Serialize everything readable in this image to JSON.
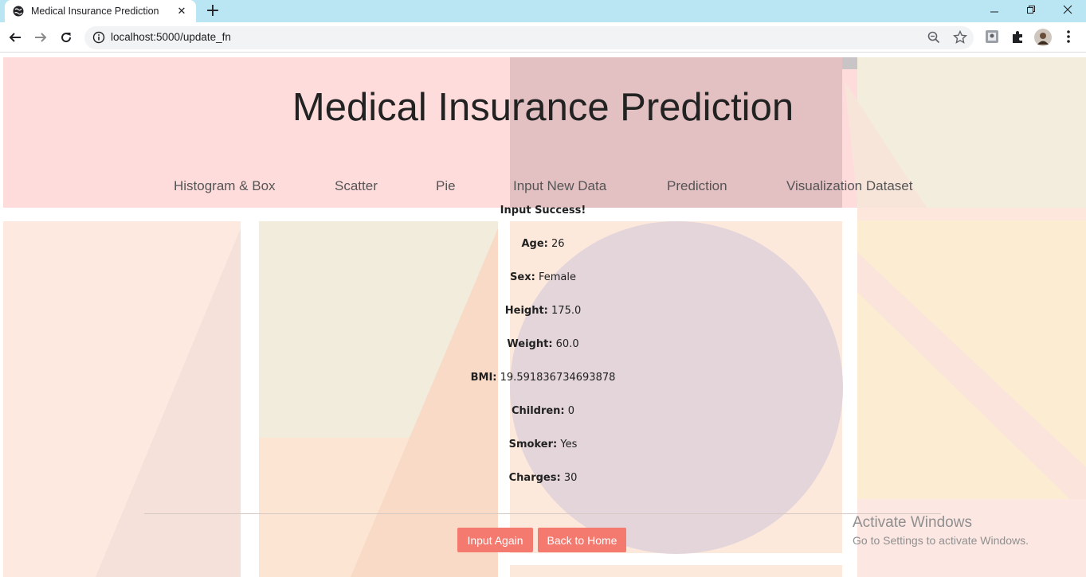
{
  "browser": {
    "tab_title": "Medical Insurance Prediction",
    "tab_close": "✕",
    "new_tab": "+",
    "url": "localhost:5000/update_fn"
  },
  "page": {
    "title": "Medical Insurance Prediction",
    "nav": [
      "Histogram & Box",
      "Scatter",
      "Pie",
      "Input New Data",
      "Prediction",
      "Visualization Dataset"
    ],
    "status": "Input Success!",
    "fields": [
      {
        "label": "Age:",
        "value": "26"
      },
      {
        "label": "Sex:",
        "value": "Female"
      },
      {
        "label": "Height:",
        "value": "175.0"
      },
      {
        "label": "Weight:",
        "value": "60.0"
      },
      {
        "label": "BMI:",
        "value": "19.591836734693878"
      },
      {
        "label": "Children:",
        "value": "0"
      },
      {
        "label": "Smoker:",
        "value": "Yes"
      },
      {
        "label": "Charges:",
        "value": "30"
      }
    ],
    "buttons": {
      "input_again": "Input Again",
      "back_home": "Back to Home"
    },
    "watermark": {
      "title": "Activate Windows",
      "subtitle": "Go to Settings to activate Windows."
    }
  },
  "colors": {
    "tabbar": "#b9e6f2",
    "button": "#f47a6f",
    "header_pink": "#ffdcdc",
    "circle": "#e3d5da"
  },
  "icons": [
    "globe-icon",
    "close-icon",
    "plus-icon",
    "minimize-icon",
    "restore-icon",
    "window-close-icon",
    "back-arrow-icon",
    "forward-arrow-icon",
    "reload-icon",
    "info-icon",
    "zoom-icon",
    "star-icon",
    "profile-extension-icon",
    "puzzle-icon",
    "avatar",
    "kebab-menu-icon"
  ]
}
